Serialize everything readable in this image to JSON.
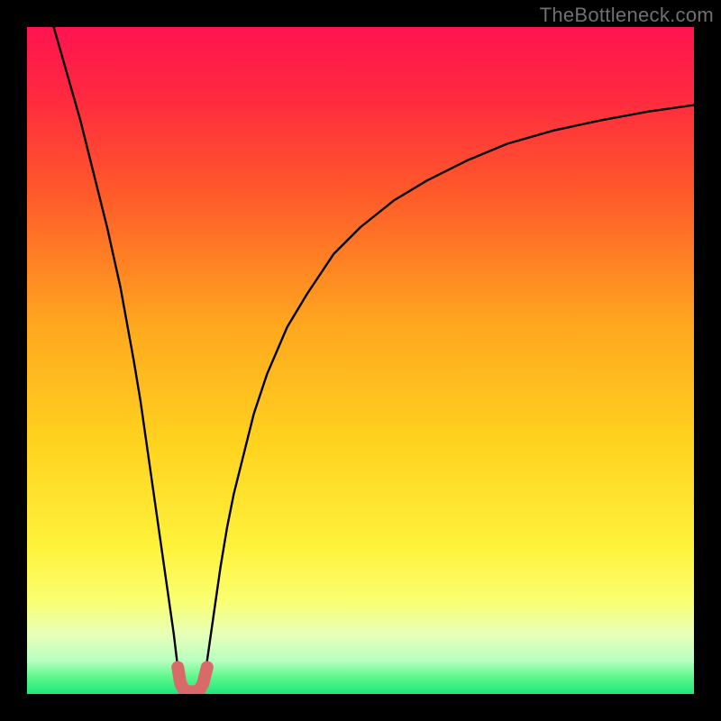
{
  "watermark": "TheBottleneck.com",
  "colors": {
    "frame": "#000000",
    "gradient_stops": [
      {
        "offset": 0.0,
        "color": "#ff1450"
      },
      {
        "offset": 0.1,
        "color": "#ff2840"
      },
      {
        "offset": 0.25,
        "color": "#ff5a2a"
      },
      {
        "offset": 0.45,
        "color": "#ffa81e"
      },
      {
        "offset": 0.62,
        "color": "#ffd21e"
      },
      {
        "offset": 0.78,
        "color": "#fff23c"
      },
      {
        "offset": 0.86,
        "color": "#faff70"
      },
      {
        "offset": 0.91,
        "color": "#e8ffb8"
      },
      {
        "offset": 0.95,
        "color": "#b8ffc0"
      },
      {
        "offset": 0.975,
        "color": "#5cf78c"
      },
      {
        "offset": 1.0,
        "color": "#1ee87a"
      }
    ],
    "curve": "#000000",
    "highlight": "#d86a6a"
  },
  "chart_data": {
    "type": "line",
    "title": "",
    "xlabel": "",
    "ylabel": "",
    "xlim": [
      0,
      100
    ],
    "ylim": [
      0,
      100
    ],
    "grid": false,
    "legend": false,
    "annotations": [],
    "series": [
      {
        "name": "curve-left",
        "x": [
          4,
          6,
          8,
          10,
          12,
          14,
          16,
          17,
          18,
          19,
          20,
          21,
          22,
          22.6,
          23
        ],
        "y": [
          100,
          93,
          86,
          78,
          70,
          61,
          50,
          44,
          37,
          30,
          23,
          16,
          9,
          4,
          1.6
        ]
      },
      {
        "name": "curve-right",
        "x": [
          26.4,
          27,
          28,
          29,
          30,
          31,
          32,
          34,
          36,
          39,
          42,
          46,
          50,
          55,
          60,
          66,
          72,
          79,
          86,
          93,
          100
        ],
        "y": [
          1.6,
          5,
          12,
          19,
          25,
          30,
          34,
          42,
          48,
          55,
          60,
          66,
          70,
          74,
          77,
          80,
          82.5,
          84.5,
          86,
          87.3,
          88.3
        ]
      },
      {
        "name": "valley-floor",
        "x": [
          23,
          23.6,
          24.7,
          25.8,
          26.4
        ],
        "y": [
          1.6,
          0.5,
          0.3,
          0.5,
          1.6
        ]
      }
    ],
    "highlight_segment": {
      "name": "u-highlight",
      "x": [
        22.6,
        23,
        23.6,
        24.7,
        25.8,
        26.4,
        27
      ],
      "y": [
        4,
        1.6,
        0.5,
        0.3,
        0.5,
        1.6,
        4
      ]
    }
  }
}
